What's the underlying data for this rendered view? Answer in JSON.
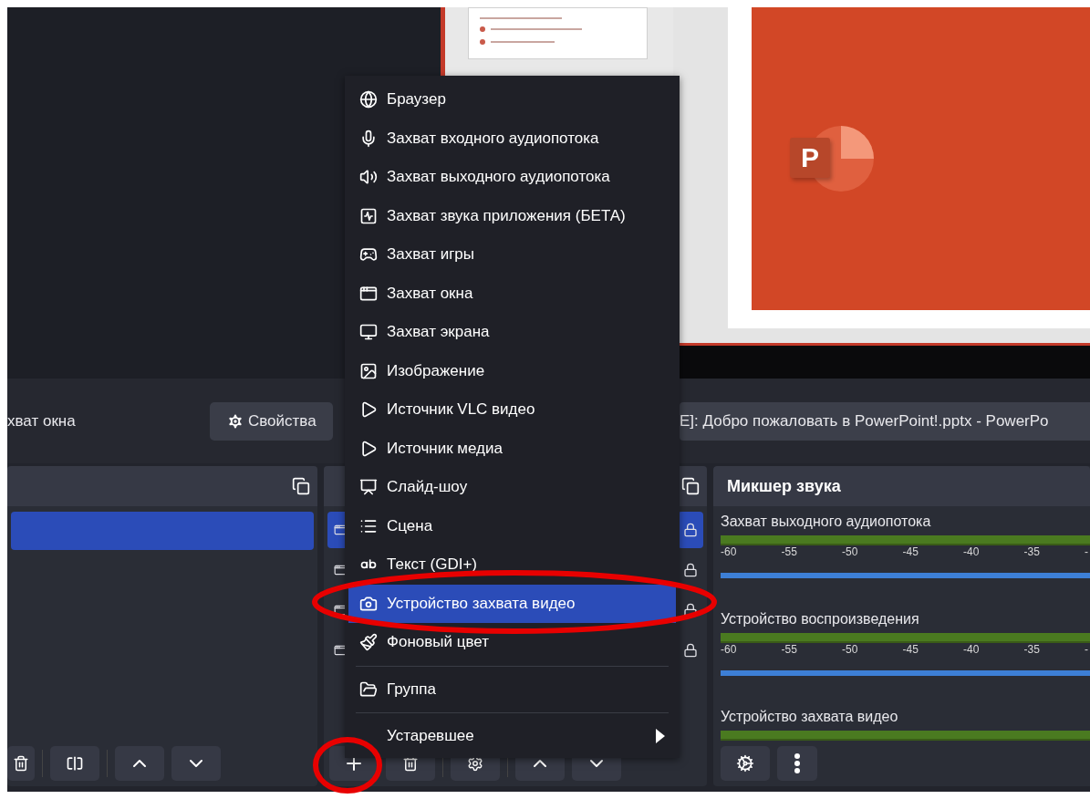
{
  "preview": {
    "logo": "P"
  },
  "source_bar": {
    "source_name": "хват окна",
    "properties_button": "Свойства",
    "window_field": "E]: Добро пожаловать в PowerPoint!.pptx - PowerPo"
  },
  "scenes": {
    "items": [
      {
        "selected": true
      }
    ]
  },
  "sources": {
    "rows": [
      {
        "selected": true
      },
      {
        "selected": false
      },
      {
        "selected": false
      },
      {
        "selected": false
      }
    ]
  },
  "mixer": {
    "title": "Микшер звука",
    "channels": [
      {
        "name": "Захват выходного аудиопотока",
        "ticks": [
          "-60",
          "-55",
          "-50",
          "-45",
          "-40",
          "-35",
          "-"
        ],
        "level": 1
      },
      {
        "name": "Устройство воспроизведения",
        "ticks": [
          "-60",
          "-55",
          "-50",
          "-45",
          "-40",
          "-35",
          "-"
        ],
        "level": 1
      },
      {
        "name": "Устройство захвата видео"
      }
    ]
  },
  "menu": {
    "items": [
      {
        "kind": "item",
        "label": "Браузер",
        "selected": false
      },
      {
        "kind": "item",
        "label": "Захват входного аудиопотока",
        "selected": false
      },
      {
        "kind": "item",
        "label": "Захват выходного аудиопотока",
        "selected": false
      },
      {
        "kind": "item",
        "label": "Захват звука приложения (БЕТА)",
        "selected": false
      },
      {
        "kind": "item",
        "label": "Захват игры",
        "selected": false
      },
      {
        "kind": "item",
        "label": "Захват окна",
        "selected": false
      },
      {
        "kind": "item",
        "label": "Захват экрана",
        "selected": false
      },
      {
        "kind": "item",
        "label": "Изображение",
        "selected": false
      },
      {
        "kind": "item",
        "label": "Источник VLC видео",
        "selected": false
      },
      {
        "kind": "item",
        "label": "Источник медиа",
        "selected": false
      },
      {
        "kind": "item",
        "label": "Слайд-шоу",
        "selected": false
      },
      {
        "kind": "item",
        "label": "Сцена",
        "selected": false
      },
      {
        "kind": "item",
        "label": "Текст (GDI+)",
        "selected": false
      },
      {
        "kind": "item",
        "label": "Устройство захвата видео",
        "selected": true
      },
      {
        "kind": "item",
        "label": "Фоновый цвет",
        "selected": false
      },
      {
        "kind": "separator"
      },
      {
        "kind": "item",
        "label": "Группа",
        "selected": false
      },
      {
        "kind": "separator"
      },
      {
        "kind": "submenu",
        "label": "Устаревшее",
        "selected": false
      }
    ]
  }
}
